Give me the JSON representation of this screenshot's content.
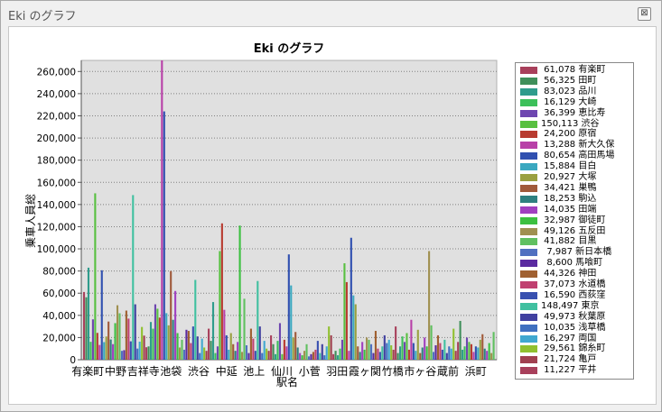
{
  "window": {
    "title": "Eki のグラフ",
    "close_label": "⊠"
  },
  "chart_data": {
    "type": "bar",
    "title": "Eki のグラフ",
    "xlabel": "駅名",
    "ylabel": "乗車人員総",
    "ylim": [
      0,
      270000
    ],
    "yticks": [
      0,
      20000,
      40000,
      60000,
      80000,
      100000,
      120000,
      140000,
      160000,
      180000,
      200000,
      220000,
      240000,
      260000
    ],
    "ytick_labels": [
      "0",
      "20,000",
      "40,000",
      "60,000",
      "80,000",
      "100,000",
      "120,000",
      "140,000",
      "160,000",
      "180,000",
      "200,000",
      "220,000",
      "240,000",
      "260,000"
    ],
    "xtick_labels": [
      "有楽町",
      "中野",
      "吉祥寺",
      "池袋",
      "渋谷",
      "中延",
      "池上",
      "仙川",
      "小菅",
      "羽田",
      "霞ヶ関",
      "竹橋",
      "市ヶ谷",
      "蔵前",
      "浜町"
    ],
    "grid": true,
    "legend_position": "right",
    "colors": [
      "#a8405b",
      "#3f8f5a",
      "#2f9c8c",
      "#3cc05a",
      "#6e46b0",
      "#58c040",
      "#b83b30",
      "#b840a8",
      "#3050b0",
      "#3aa8c0",
      "#9aa040",
      "#a05a3a",
      "#2e8080",
      "#a040c0",
      "#3cc040",
      "#a09050",
      "#60c060",
      "#5070c0",
      "#5a2aa0",
      "#a06030",
      "#c04070",
      "#3850b0",
      "#40c0a0",
      "#4040a0",
      "#4070c0",
      "#40a8d0",
      "#90c030",
      "#a04050"
    ],
    "legend": [
      {
        "value": "61,078",
        "name": "有楽町"
      },
      {
        "value": "56,325",
        "name": "田町"
      },
      {
        "value": "83,023",
        "name": "品川"
      },
      {
        "value": "16,129",
        "name": "大崎"
      },
      {
        "value": "36,399",
        "name": "恵比寿"
      },
      {
        "value": "150,113",
        "name": "渋谷"
      },
      {
        "value": "24,200",
        "name": "原宿"
      },
      {
        "value": "13,288",
        "name": "新大久保"
      },
      {
        "value": "80,654",
        "name": "高田馬場"
      },
      {
        "value": "15,884",
        "name": "目白"
      },
      {
        "value": "20,927",
        "name": "大塚"
      },
      {
        "value": "34,421",
        "name": "巣鴨"
      },
      {
        "value": "18,253",
        "name": "駒込"
      },
      {
        "value": "14,035",
        "name": "田端"
      },
      {
        "value": "32,987",
        "name": "御徒町"
      },
      {
        "value": "49,126",
        "name": "五反田"
      },
      {
        "value": "41,882",
        "name": "目黒"
      },
      {
        "value": "7,987",
        "name": "新日本橋"
      },
      {
        "value": "8,600",
        "name": "馬喰町"
      },
      {
        "value": "44,326",
        "name": "神田"
      },
      {
        "value": "37,073",
        "name": "水道橋"
      },
      {
        "value": "16,590",
        "name": "西荻窪"
      },
      {
        "value": "148,497",
        "name": "東京"
      },
      {
        "value": "49,973",
        "name": "秋葉原"
      },
      {
        "value": "10,035",
        "name": "浅草橋"
      },
      {
        "value": "16,297",
        "name": "両国"
      },
      {
        "value": "29,561",
        "name": "錦糸町"
      },
      {
        "value": "21,724",
        "name": "亀戸"
      },
      {
        "value": "11,227",
        "name": "平井"
      }
    ],
    "values": [
      61078,
      56325,
      83023,
      16129,
      36399,
      150113,
      24200,
      13288,
      80654,
      15884,
      20927,
      34421,
      18253,
      14035,
      32987,
      49126,
      41882,
      7987,
      8600,
      44326,
      37073,
      16590,
      148497,
      49973,
      10035,
      16297,
      29561,
      21724,
      11227,
      12000,
      34000,
      28000,
      50000,
      46000,
      38000,
      270000,
      224000,
      42000,
      31000,
      80000,
      36000,
      62000,
      24000,
      11000,
      18000,
      9000,
      27000,
      26000,
      15000,
      30000,
      72000,
      21000,
      6000,
      19000,
      11000,
      8000,
      28000,
      17000,
      52000,
      6000,
      12000,
      98000,
      123000,
      45000,
      22000,
      9000,
      24000,
      14000,
      8000,
      16000,
      121000,
      7000,
      55000,
      13000,
      6000,
      28000,
      19000,
      8000,
      71000,
      30000,
      6000,
      17000,
      10000,
      8000,
      22000,
      14000,
      5000,
      17000,
      33000,
      5000,
      18000,
      12000,
      95000,
      67000,
      20000,
      25000,
      11000,
      6000,
      4000,
      8000,
      14000,
      3000,
      5000,
      7000,
      9000,
      17000,
      6000,
      14000,
      4000,
      12000,
      30000,
      22000,
      5000,
      8000,
      4000,
      10000,
      18000,
      87000,
      70000,
      8000,
      110000,
      58000,
      50000,
      12000,
      7000,
      16000,
      9000,
      20000,
      18000,
      14000,
      6000,
      26000,
      10000,
      7000,
      12000,
      22000,
      15000,
      18000,
      13000,
      9000,
      30000,
      6000,
      12000,
      21000,
      16000,
      24000,
      9000,
      36000,
      15000,
      8000,
      27000,
      6000,
      11000,
      20000,
      12000,
      98000,
      31000,
      7000,
      13000,
      22000,
      15000,
      9000,
      18000,
      6000,
      12000,
      10000,
      28000,
      8000,
      16000,
      35000,
      9000,
      12000,
      20000,
      16000,
      14000,
      7000,
      12000,
      11000,
      18000,
      23000,
      10000,
      8000,
      15000,
      6000,
      25000
    ]
  }
}
